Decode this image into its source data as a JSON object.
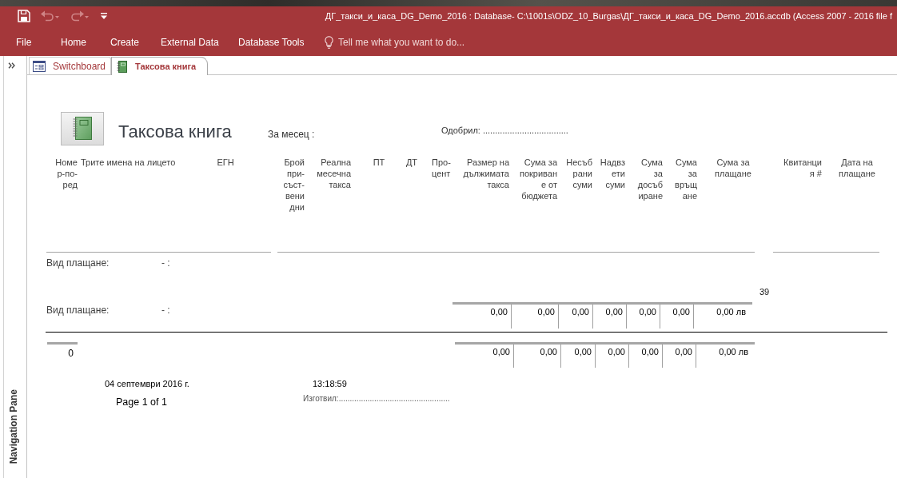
{
  "title_bar": {
    "quick_access": [
      {
        "kind": "save",
        "disabled": false
      },
      {
        "kind": "undo",
        "disabled": true
      },
      {
        "kind": "redo",
        "disabled": true
      },
      {
        "kind": "customize",
        "disabled": false
      }
    ],
    "title": "ДГ_такси_и_каса_DG_Demo_2016 : Database- C:\\1001s\\ODZ_10_Burgas\\ДГ_такси_и_каса_DG_Demo_2016.accdb (Access 2007 - 2016 file f"
  },
  "ribbon": {
    "tabs": [
      {
        "label": "File"
      },
      {
        "label": "Home"
      },
      {
        "label": "Create"
      },
      {
        "label": "External Data"
      },
      {
        "label": "Database Tools"
      }
    ],
    "tell_me": {
      "placeholder": "Tell me what you want to do..."
    }
  },
  "navigation_pane": {
    "label": "Navigation Pane"
  },
  "document_tabs": [
    {
      "label": "Switchboard",
      "kind": "form",
      "selected": false
    },
    {
      "label": "Таксова книга",
      "kind": "report",
      "selected": true
    }
  ],
  "report": {
    "title": "Таксова книга",
    "month_label": "За месец :",
    "approved_by": "Одобрил: ...................................",
    "columns": [
      "Номе р-по- ред",
      "Трите имена на лицето",
      "ЕГН",
      "Брой при- съст- вени дни",
      "Реална месечна такса",
      "ПТ",
      "ДТ",
      "Про- цент",
      "Размер на дължимата такса",
      "Сума за покриван е от бюджета",
      "Несъб рани суми",
      "Надвз ети суми",
      "Сума за досъб иране",
      "Сума за връщ ане",
      "Сума за плащане",
      "Квитанци я #",
      "Дата на плащане"
    ],
    "group_header": {
      "label": "Вид плащане:",
      "value": "- :"
    },
    "group_count": "39",
    "group_footer": {
      "label": "Вид плащане:",
      "value": "- :",
      "totals": [
        "0,00",
        "0,00",
        "0,00",
        "0,00",
        "0,00",
        "0,00",
        "0,00 лв"
      ]
    },
    "report_footer": {
      "count": "0",
      "totals": [
        "0,00",
        "0,00",
        "0,00",
        "0,00",
        "0,00",
        "0,00",
        "0,00 лв"
      ]
    },
    "page_footer": {
      "date": "04 септември 2016 г.",
      "time": "13:18:59",
      "page": "Page 1 of 1",
      "prepared_by": "Изготвил:.................................................."
    }
  }
}
